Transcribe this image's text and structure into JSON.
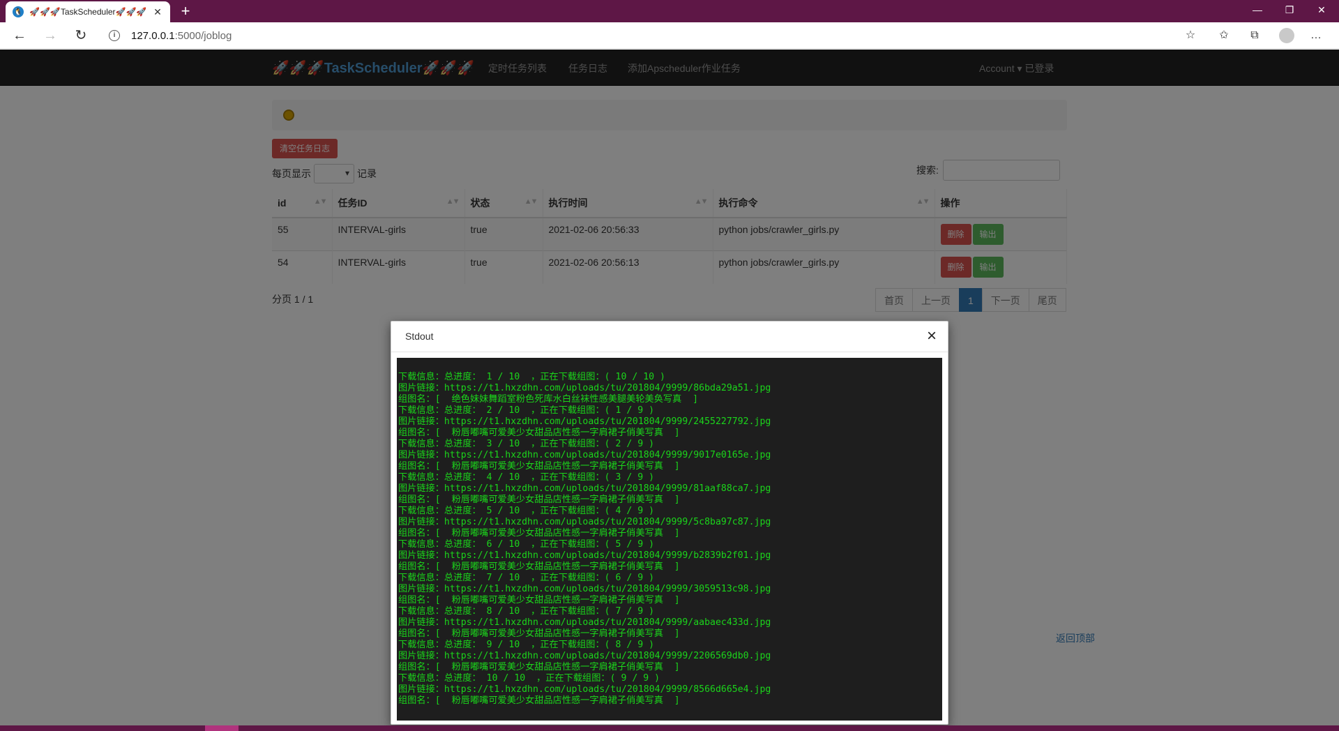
{
  "browser": {
    "tab_title": "🚀🚀🚀TaskScheduler🚀🚀🚀",
    "url_host": "127.0.0.1",
    "url_path": ":5000/joblog"
  },
  "navbar": {
    "brand": "🚀🚀🚀TaskScheduler🚀🚀🚀",
    "links": [
      "定时任务列表",
      "任务日志",
      "添加Apscheduler作业任务"
    ],
    "account": "Account ▾ 已登录"
  },
  "toolbar": {
    "clear_label": "清空任务日志",
    "per_page_prefix": "每页显示",
    "per_page_suffix": "记录",
    "search_label": "搜索:"
  },
  "table": {
    "headers": [
      "id",
      "任务ID",
      "状态",
      "执行时间",
      "执行命令",
      "操作"
    ],
    "rows": [
      {
        "id": "55",
        "job_id": "INTERVAL-girls",
        "status": "true",
        "time": "2021-02-06 20:56:33",
        "cmd": "python jobs/crawler_girls.py"
      },
      {
        "id": "54",
        "job_id": "INTERVAL-girls",
        "status": "true",
        "time": "2021-02-06 20:56:13",
        "cmd": "python jobs/crawler_girls.py"
      }
    ],
    "delete_label": "删除",
    "output_label": "输出"
  },
  "pagination": {
    "info": "分页 1 / 1",
    "first": "首页",
    "prev": "上一页",
    "current": "1",
    "next": "下一页",
    "last": "尾页"
  },
  "back_to_top": "返回顶部",
  "modal": {
    "title": "Stdout",
    "close": "×",
    "lines": [
      "下载信息：总进度： 1 / 10  ，正在下载组图：( 10 / 10 )",
      "图片链接：https://t1.hxzdhn.com/uploads/tu/201804/9999/86bda29a51.jpg",
      "组图名：[  绝色妹妹舞蹈室粉色死库水白丝袜性感美腿美轮美奂写真  ]",
      "下载信息：总进度： 2 / 10  ，正在下载组图：( 1 / 9 )",
      "图片链接：https://t1.hxzdhn.com/uploads/tu/201804/9999/2455227792.jpg",
      "组图名：[  粉唇嘟嘴可爱美少女甜品店性感一字肩裙子俏美写真  ]",
      "下载信息：总进度： 3 / 10  ，正在下载组图：( 2 / 9 )",
      "图片链接：https://t1.hxzdhn.com/uploads/tu/201804/9999/9017e0165e.jpg",
      "组图名：[  粉唇嘟嘴可爱美少女甜品店性感一字肩裙子俏美写真  ]",
      "下载信息：总进度： 4 / 10  ，正在下载组图：( 3 / 9 )",
      "图片链接：https://t1.hxzdhn.com/uploads/tu/201804/9999/81aaf88ca7.jpg",
      "组图名：[  粉唇嘟嘴可爱美少女甜品店性感一字肩裙子俏美写真  ]",
      "下载信息：总进度： 5 / 10  ，正在下载组图：( 4 / 9 )",
      "图片链接：https://t1.hxzdhn.com/uploads/tu/201804/9999/5c8ba97c87.jpg",
      "组图名：[  粉唇嘟嘴可爱美少女甜品店性感一字肩裙子俏美写真  ]",
      "下载信息：总进度： 6 / 10  ，正在下载组图：( 5 / 9 )",
      "图片链接：https://t1.hxzdhn.com/uploads/tu/201804/9999/b2839b2f01.jpg",
      "组图名：[  粉唇嘟嘴可爱美少女甜品店性感一字肩裙子俏美写真  ]",
      "下载信息：总进度： 7 / 10  ，正在下载组图：( 6 / 9 )",
      "图片链接：https://t1.hxzdhn.com/uploads/tu/201804/9999/3059513c98.jpg",
      "组图名：[  粉唇嘟嘴可爱美少女甜品店性感一字肩裙子俏美写真  ]",
      "下载信息：总进度： 8 / 10  ，正在下载组图：( 7 / 9 )",
      "图片链接：https://t1.hxzdhn.com/uploads/tu/201804/9999/aabaec433d.jpg",
      "组图名：[  粉唇嘟嘴可爱美少女甜品店性感一字肩裙子俏美写真  ]",
      "下载信息：总进度： 9 / 10  ，正在下载组图：( 8 / 9 )",
      "图片链接：https://t1.hxzdhn.com/uploads/tu/201804/9999/2206569db0.jpg",
      "组图名：[  粉唇嘟嘴可爱美少女甜品店性感一字肩裙子俏美写真  ]",
      "下载信息：总进度： 10 / 10  ，正在下载组图：( 9 / 9 )",
      "图片链接：https://t1.hxzdhn.com/uploads/tu/201804/9999/8566d665e4.jpg",
      "组图名：[  粉唇嘟嘴可爱美少女甜品店性感一字肩裙子俏美写真  ]"
    ]
  },
  "colors": {
    "titlebar": "#5e1746",
    "navbar": "#222222",
    "brand": "#4f9bd3",
    "console_bg": "#1e1e1e",
    "console_text": "#1bd51b",
    "danger": "#d9534f",
    "success": "#5cb85c",
    "primary": "#337ab7"
  },
  "icons": {
    "tab_favicon": "penguin-icon",
    "info": "info-icon",
    "favorite": "star-add-icon",
    "collections": "collections-icon",
    "profile": "avatar-icon",
    "menu": "more-icon"
  }
}
